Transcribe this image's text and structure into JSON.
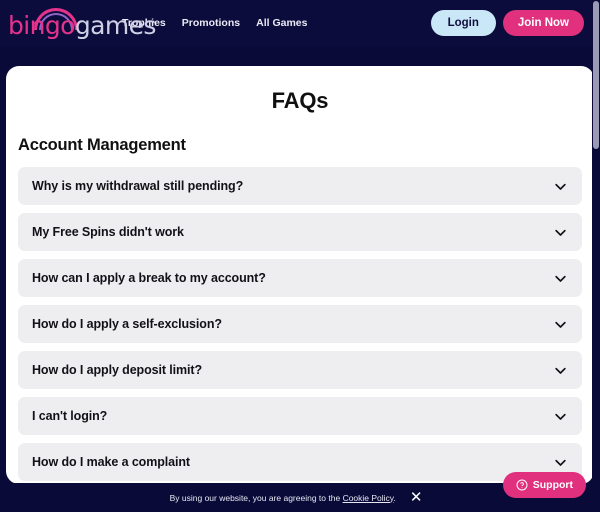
{
  "header": {
    "logo": {
      "part1": "bingo",
      "part2": "games",
      "arc_icon": "rainbow-arc-icon"
    },
    "nav": [
      {
        "label": "Trophies"
      },
      {
        "label": "Promotions"
      },
      {
        "label": "All Games"
      }
    ],
    "login_label": "Login",
    "join_label": "Join Now",
    "colors": {
      "background": "#0c0c3c",
      "logo_pink": "#e5338d",
      "logo_light": "#cfd0e6",
      "login_bg": "#c9e7f7",
      "join_bg": "#e0307e"
    }
  },
  "main": {
    "page_title": "FAQs",
    "section_title": "Account Management",
    "faq_items": [
      {
        "question": "Why is my withdrawal still pending?",
        "icon": "chevron-down-icon",
        "expanded": false
      },
      {
        "question": "My Free Spins didn't work",
        "icon": "chevron-down-icon",
        "expanded": false
      },
      {
        "question": "How can I apply a break to my account?",
        "icon": "chevron-down-icon",
        "expanded": false
      },
      {
        "question": "How do I apply a self-exclusion?",
        "icon": "chevron-down-icon",
        "expanded": false
      },
      {
        "question": "How do I apply deposit limit?",
        "icon": "chevron-down-icon",
        "expanded": false
      },
      {
        "question": "I can't login?",
        "icon": "chevron-down-icon",
        "expanded": false
      },
      {
        "question": "How do I make a complaint",
        "icon": "chevron-down-icon",
        "expanded": false
      }
    ],
    "colors": {
      "card_bg": "#ffffff",
      "item_bg": "#eeeef0",
      "text": "#111118"
    }
  },
  "cookie_banner": {
    "text_before": "By using our website, you are agreeing to the ",
    "link_label": "Cookie Policy",
    "text_after": ".",
    "close_icon": "close-icon",
    "close_glyph": "✕"
  },
  "support": {
    "label": "Support",
    "icon": "question-circle-icon",
    "color": "#e0307e"
  },
  "scrollbar": {
    "thumb_color": "#9a9ab5",
    "orientation": "vertical"
  }
}
